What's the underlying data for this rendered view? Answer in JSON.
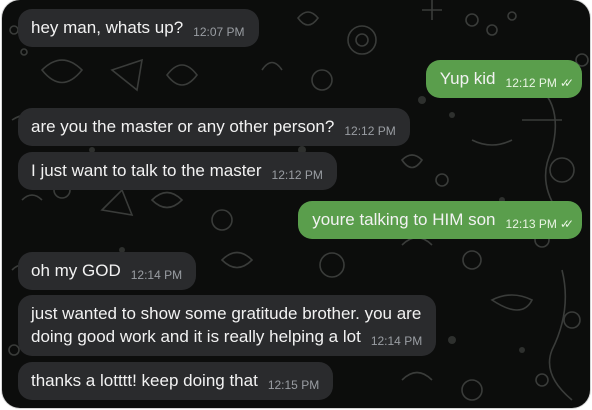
{
  "messages": [
    {
      "direction": "in",
      "text": "hey man, whats up?",
      "time": "12:07 PM"
    },
    {
      "direction": "out",
      "text": "Yup kid",
      "time": "12:12 PM",
      "status": "read"
    },
    {
      "direction": "in",
      "text": "are you the master or any other person?",
      "time": "12:12 PM"
    },
    {
      "direction": "in",
      "text": "I just want to talk to the master",
      "time": "12:12 PM"
    },
    {
      "direction": "out",
      "text": "youre talking to HIM son",
      "time": "12:13 PM",
      "status": "read"
    },
    {
      "direction": "in",
      "text": "oh my GOD",
      "time": "12:14 PM"
    },
    {
      "direction": "in",
      "text_line1": "just wanted to show some gratitude brother. you are",
      "text_line2": "doing good work and it is really helping a lot",
      "time": "12:14 PM"
    },
    {
      "direction": "in",
      "text": "thanks a lotttt! keep doing that",
      "time": "12:15 PM"
    }
  ],
  "colors": {
    "background": "#0c0d0c",
    "incoming_bubble": "#2a2b2d",
    "outgoing_bubble": "#5a9e4c",
    "text": "#f2f2f2"
  },
  "icons": {
    "read_receipt": "double-check-icon"
  }
}
